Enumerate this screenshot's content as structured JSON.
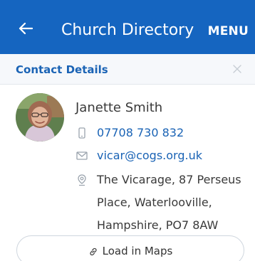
{
  "app_bar": {
    "title": "Church Directory",
    "menu_label": "MENU",
    "back_icon": "arrow-left-icon",
    "background_color": "#1565c0"
  },
  "section": {
    "title": "Contact Details",
    "close_icon": "close-icon"
  },
  "contact": {
    "name": "Janette Smith",
    "phone": "07708 730 832",
    "email": "vicar@cogs.org.uk",
    "address_lines": [
      "The Vicarage, 87 Perseus",
      "Place, Waterlooville,",
      "Hampshire, PO7 8AW"
    ],
    "phone_icon": "mobile-phone-icon",
    "email_icon": "envelope-icon",
    "address_icon": "map-pin-icon",
    "avatar_icon": "avatar-photo"
  },
  "maps_button": {
    "label": "Load in Maps",
    "icon": "link-icon"
  }
}
